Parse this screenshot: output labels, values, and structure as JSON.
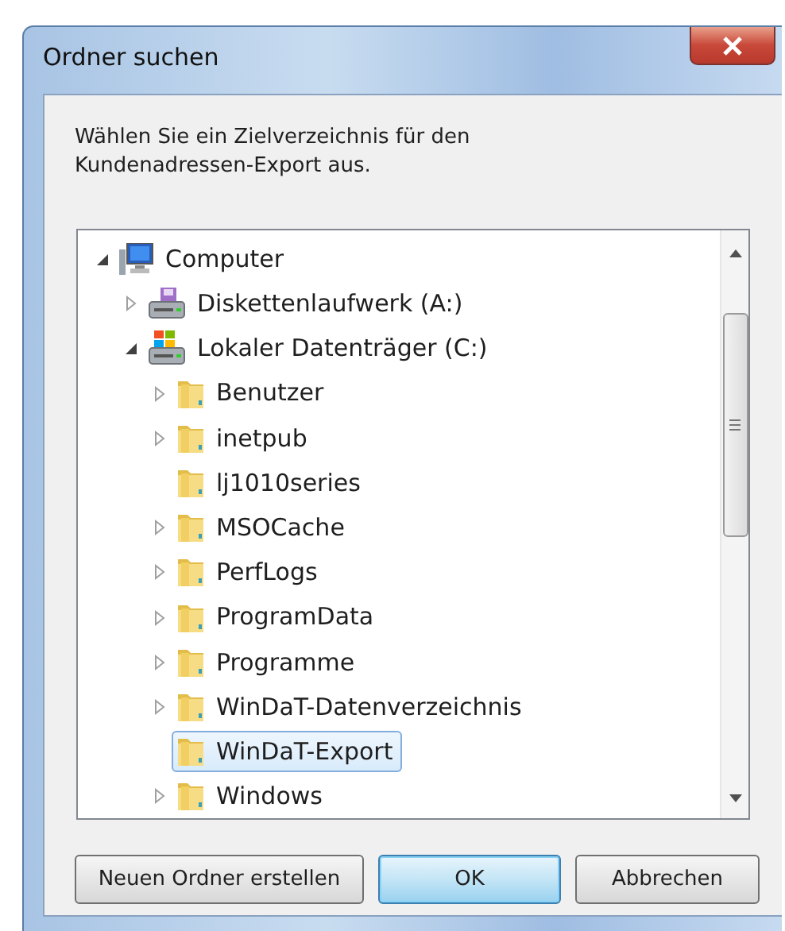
{
  "window": {
    "title": "Ordner suchen"
  },
  "message": "Wählen Sie ein Zielverzeichnis für den Kundenadressen-Export aus.",
  "tree": [
    {
      "label": "Computer",
      "kind": "computer",
      "expanded": true,
      "selected": false,
      "children": [
        {
          "label": "Diskettenlaufwerk (A:)",
          "kind": "floppy",
          "expanded": false,
          "selected": false
        },
        {
          "label": "Lokaler Datenträger (C:)",
          "kind": "drive",
          "expanded": true,
          "selected": false,
          "children": [
            {
              "label": "Benutzer",
              "kind": "folder",
              "expanded": false,
              "selected": false
            },
            {
              "label": "inetpub",
              "kind": "folder",
              "expanded": false,
              "selected": false
            },
            {
              "label": "lj1010series",
              "kind": "folder",
              "selected": false
            },
            {
              "label": "MSOCache",
              "kind": "folder",
              "expanded": false,
              "selected": false
            },
            {
              "label": "PerfLogs",
              "kind": "folder",
              "expanded": false,
              "selected": false
            },
            {
              "label": "ProgramData",
              "kind": "folder",
              "expanded": false,
              "selected": false
            },
            {
              "label": "Programme",
              "kind": "folder",
              "expanded": false,
              "selected": false
            },
            {
              "label": "WinDaT-Datenverzeichnis",
              "kind": "folder",
              "expanded": false,
              "selected": false
            },
            {
              "label": "WinDaT-Export",
              "kind": "folder",
              "selected": true
            },
            {
              "label": "Windows",
              "kind": "folder",
              "expanded": false,
              "selected": false
            }
          ]
        }
      ]
    }
  ],
  "buttons": [
    {
      "label": "Neuen Ordner erstellen",
      "default": false
    },
    {
      "label": "OK",
      "default": true
    },
    {
      "label": "Abbrechen",
      "default": false
    }
  ]
}
